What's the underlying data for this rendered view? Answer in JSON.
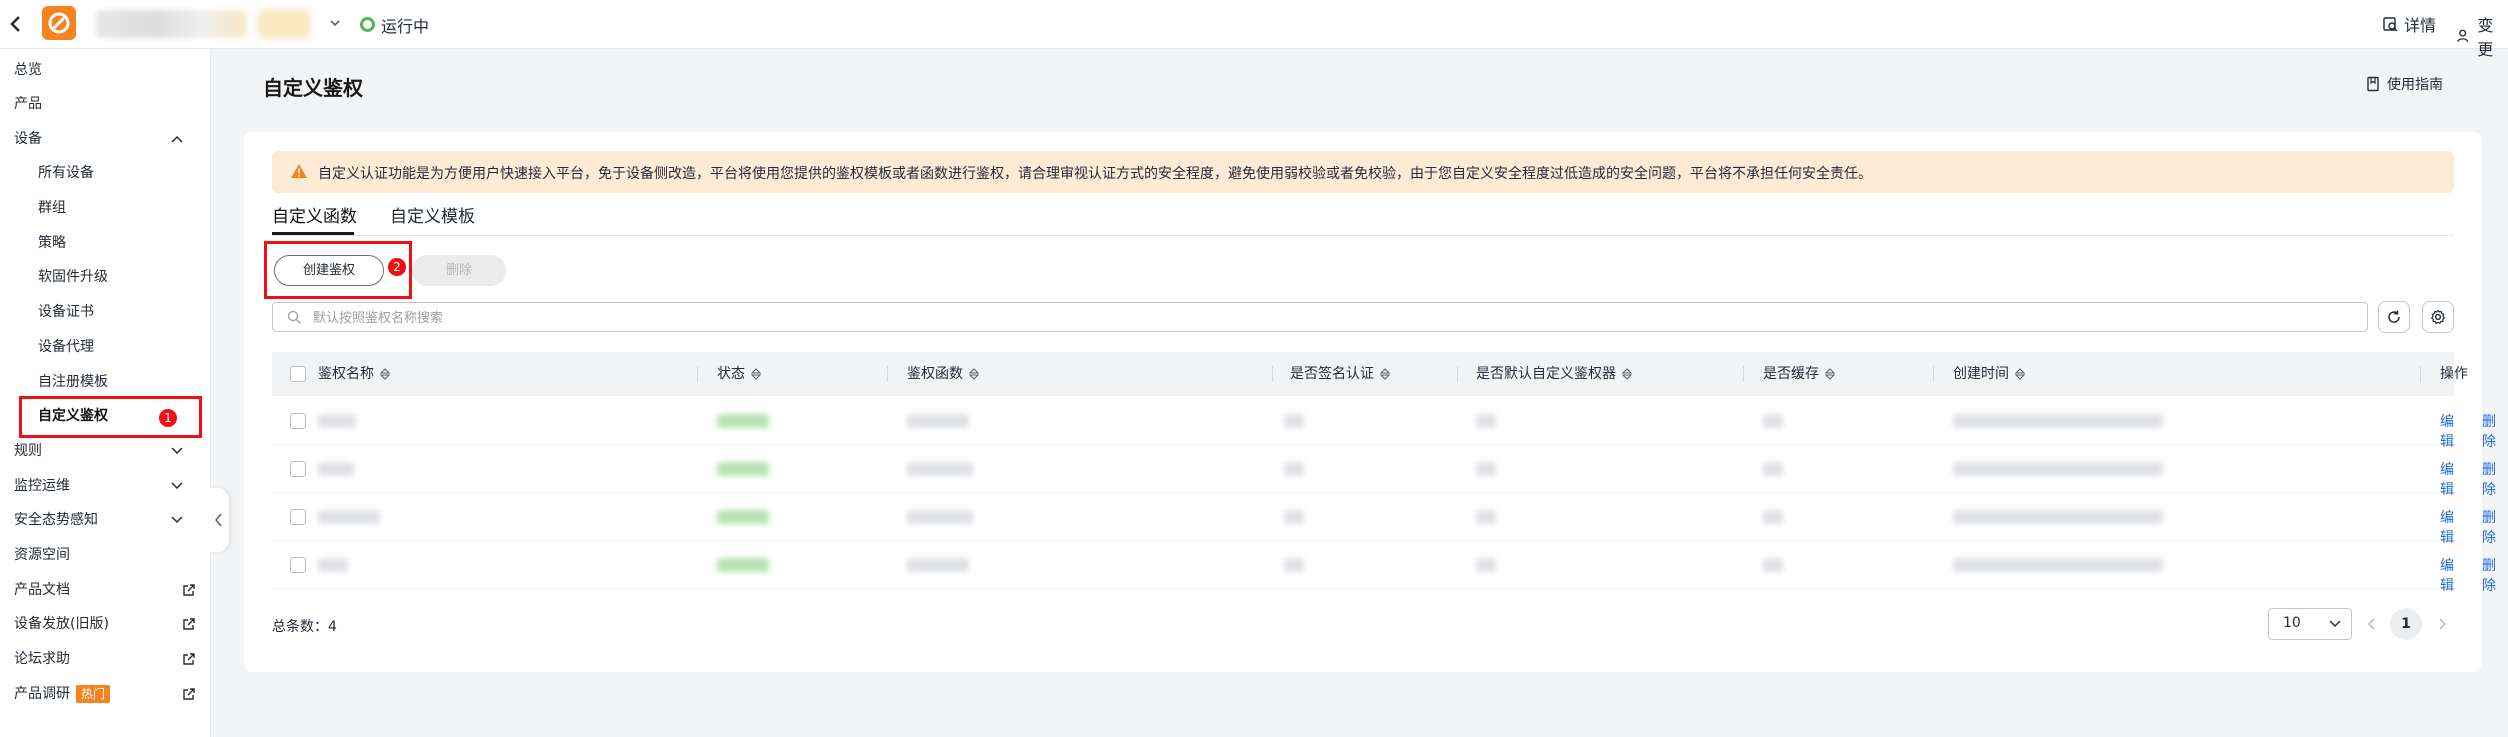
{
  "topbar": {
    "status_text": "运行中",
    "detail_label": "详情",
    "change_label": "变更"
  },
  "sidebar": {
    "items": [
      {
        "label": "总览"
      },
      {
        "label": "产品"
      },
      {
        "label": "设备"
      },
      {
        "label": "所有设备"
      },
      {
        "label": "群组"
      },
      {
        "label": "策略"
      },
      {
        "label": "软固件升级"
      },
      {
        "label": "设备证书"
      },
      {
        "label": "设备代理"
      },
      {
        "label": "自注册模板"
      },
      {
        "label": "自定义鉴权"
      },
      {
        "label": "规则"
      },
      {
        "label": "监控运维"
      },
      {
        "label": "安全态势感知"
      },
      {
        "label": "资源空间"
      },
      {
        "label": "产品文档"
      },
      {
        "label": "设备发放(旧版)"
      },
      {
        "label": "论坛求助"
      },
      {
        "label": "产品调研",
        "tag": "热门"
      }
    ]
  },
  "annotations": {
    "badge1": "1",
    "badge2": "2"
  },
  "main": {
    "title": "自定义鉴权",
    "guide_label": "使用指南",
    "alert": "自定义认证功能是为方便用户快速接入平台，免于设备侧改造，平台将使用您提供的鉴权模板或者函数进行鉴权，请合理审视认证方式的安全程度，避免使用弱校验或者免校验，由于您自定义安全程度过低造成的安全问题，平台将不承担任何安全责任。",
    "tabs": [
      {
        "label": "自定义函数"
      },
      {
        "label": "自定义模板"
      }
    ],
    "create_button": "创建鉴权",
    "delete_button": "删除",
    "search_placeholder": "默认按照鉴权名称搜索",
    "columns": [
      {
        "label": "鉴权名称"
      },
      {
        "label": "状态"
      },
      {
        "label": "鉴权函数"
      },
      {
        "label": "是否签名认证"
      },
      {
        "label": "是否默认自定义鉴权器"
      },
      {
        "label": "是否缓存"
      },
      {
        "label": "创建时间"
      },
      {
        "label": "操作"
      }
    ],
    "row_actions": {
      "edit": "编辑",
      "delete": "删除"
    },
    "total_label": "总条数：",
    "total": "4",
    "page_size": "10",
    "current_page": "1"
  },
  "colors": {
    "accent": "#f5831f",
    "link": "#1d6fe0",
    "highlight": "#e11111",
    "status_green": "#50b848",
    "alert_bg": "#fdebd6"
  }
}
